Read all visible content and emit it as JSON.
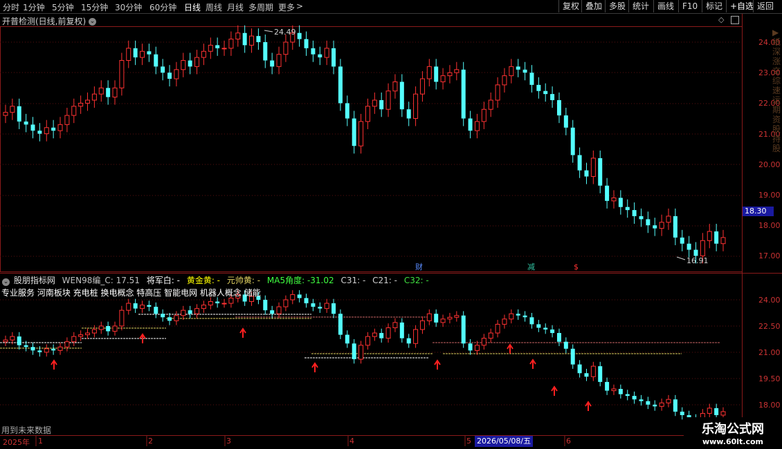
{
  "toolbar": {
    "periods": [
      "分时",
      "1分钟",
      "5分钟",
      "15分钟",
      "30分钟",
      "60分钟",
      "日线",
      "周线",
      "月线",
      "多周期",
      "更多"
    ],
    "more_arrow": ">",
    "right_buttons": [
      "复权",
      "叠加",
      "多股",
      "统计",
      "画线",
      "F10",
      "标记",
      "+自选",
      "返回"
    ]
  },
  "main_chart": {
    "title": "开普检测(日线,前复权)",
    "high_label": "24.49",
    "low_label": "16.91",
    "price_axis": [
      "24.00",
      "23.00",
      "22.00",
      "21.00",
      "20.00",
      "19.00",
      "18.00",
      "17.00"
    ],
    "current_price": "18.30",
    "markers": {
      "cai": "财",
      "jian": "减",
      "dollar": "$"
    },
    "colors": {
      "up": "#ff3232",
      "down": "#54ffff",
      "grid": "#8b1a1a",
      "axis_text": "#cc3333",
      "current_bg": "#1a1aa0"
    }
  },
  "indicator": {
    "name": "股朋指标网",
    "formula": "WEN98编_C: 17.51",
    "jiang": "将军白: -",
    "huang": "黄金黄: -",
    "yuanshuai": "元帅黄: -",
    "ma5": "MA5角度: -31.02",
    "c31": "C31: -",
    "c21": "C21: -",
    "c32": "C32: -",
    "concepts": "专业服务  河南板块  充电桩  换电概念  特高压  智能电网  机器人概念  储能",
    "future_note": "用到未来数据",
    "axis": [
      "24.00",
      "22.50",
      "21.00",
      "19.50",
      "18.00"
    ]
  },
  "date_bar": {
    "year": "2025年",
    "months": [
      "1",
      "2",
      "3",
      "4",
      "5",
      "6"
    ],
    "cursor_date": "2026/05/08/五"
  },
  "watermark": {
    "name": "乐淘公式网",
    "url": "www.60lt.com"
  }
}
